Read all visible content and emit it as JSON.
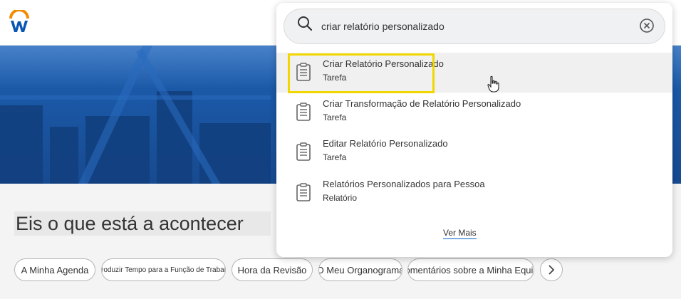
{
  "app": {
    "logo_icon": "workday-logo-icon"
  },
  "hero": {
    "image": "city-skyline-photo"
  },
  "page": {
    "title": "Eis o que está a acontecer"
  },
  "quick_links": [
    {
      "label": "A Minha Agenda"
    },
    {
      "label": "Introduzir Tempo para a Função de Trabalho"
    },
    {
      "label": "Hora da Revisão"
    },
    {
      "label": "O Meu Organograma"
    },
    {
      "label": "Comentários sobre a Minha Equipa"
    }
  ],
  "search": {
    "query": "criar relatório personalizado",
    "search_icon": "search-icon",
    "clear_icon": "clear-icon",
    "results": [
      {
        "title": "Criar Relatório Personalizado",
        "type": "Tarefa"
      },
      {
        "title": "Criar Transformação de Relatório Personalizado",
        "type": "Tarefa"
      },
      {
        "title": "Editar Relatório Personalizado",
        "type": "Tarefa"
      },
      {
        "title": "Relatórios Personalizados para Pessoa",
        "type": "Relatório"
      }
    ],
    "see_more": "Ver Mais"
  },
  "colors": {
    "brand_blue": "#0a56b4",
    "brand_orange": "#f38b00",
    "highlight": "#f2d600"
  }
}
